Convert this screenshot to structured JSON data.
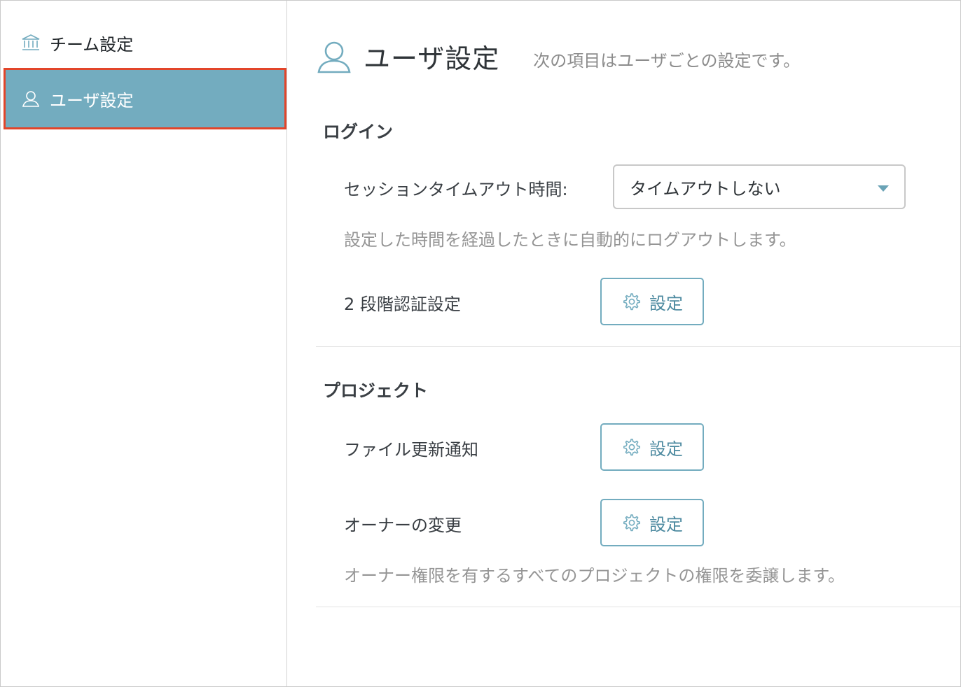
{
  "sidebar": {
    "items": [
      {
        "label": "チーム設定",
        "icon": "bank-icon",
        "active": false
      },
      {
        "label": "ユーザ設定",
        "icon": "user-icon",
        "active": true
      }
    ]
  },
  "header": {
    "title": "ユーザ設定",
    "subtitle": "次の項目はユーザごとの設定です。",
    "icon": "user-icon"
  },
  "login": {
    "title": "ログイン",
    "session_timeout_label": "セッションタイムアウト時間:",
    "session_timeout_value": "タイムアウトしない",
    "session_timeout_desc": "設定した時間を経過したときに自動的にログアウトします。",
    "two_factor_label": "2 段階認証設定",
    "two_factor_button": "設定"
  },
  "project": {
    "title": "プロジェクト",
    "file_notify_label": "ファイル更新通知",
    "file_notify_button": "設定",
    "owner_change_label": "オーナーの変更",
    "owner_change_button": "設定",
    "owner_change_desc": "オーナー権限を有するすべてのプロジェクトの権限を委譲します。"
  },
  "colors": {
    "accent": "#73acbf",
    "highlight_border": "#e2452a",
    "muted_text": "#959595"
  }
}
